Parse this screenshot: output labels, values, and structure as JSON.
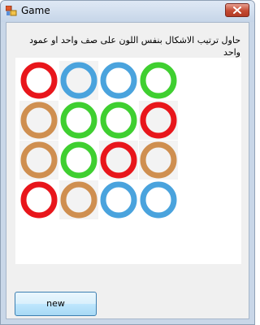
{
  "window": {
    "title": "Game",
    "icon": "app-form-icon",
    "close_icon": "close-x-icon"
  },
  "instruction": "حاول ترتيب الاشكال بنفس اللون على صف واحد او عمود واحد",
  "board": {
    "rows": 4,
    "cols": 4,
    "colors": {
      "red": "#e8161b",
      "blue": "#4aa3dd",
      "green": "#3fcf30",
      "tan": "#cf8f50"
    },
    "cells": [
      [
        "red",
        "blue",
        "blue",
        "green"
      ],
      [
        "tan",
        "green",
        "green",
        "red"
      ],
      [
        "tan",
        "green",
        "red",
        "tan"
      ],
      [
        "red",
        "tan",
        "blue",
        "blue"
      ]
    ]
  },
  "buttons": {
    "new_label": "new"
  }
}
